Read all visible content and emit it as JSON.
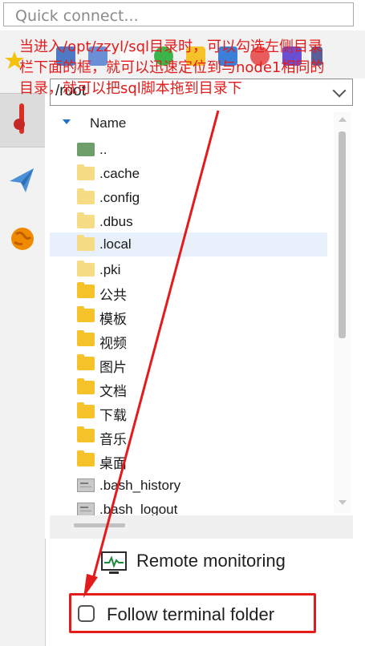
{
  "quick_connect": {
    "placeholder": "Quick connect..."
  },
  "path": {
    "value": "/root"
  },
  "file_list": {
    "header": "Name",
    "items": [
      {
        "name": "..",
        "type": "up"
      },
      {
        "name": ".cache",
        "type": "folder-light"
      },
      {
        "name": ".config",
        "type": "folder-light"
      },
      {
        "name": ".dbus",
        "type": "folder-light"
      },
      {
        "name": ".local",
        "type": "folder-light",
        "selected": true
      },
      {
        "name": ".pki",
        "type": "folder-light"
      },
      {
        "name": "公共",
        "type": "folder"
      },
      {
        "name": "模板",
        "type": "folder"
      },
      {
        "name": "视频",
        "type": "folder"
      },
      {
        "name": "图片",
        "type": "folder"
      },
      {
        "name": "文档",
        "type": "folder"
      },
      {
        "name": "下载",
        "type": "folder"
      },
      {
        "name": "音乐",
        "type": "folder"
      },
      {
        "name": "桌面",
        "type": "folder"
      },
      {
        "name": ".bash_history",
        "type": "file"
      },
      {
        "name": ".bash_logout",
        "type": "file"
      }
    ]
  },
  "remote_monitoring": {
    "label": "Remote monitoring"
  },
  "follow_terminal": {
    "label": "Follow terminal folder",
    "checked": false
  },
  "annotation": {
    "lines": [
      "当进入/opt/zzyl/sql目录时，可以勾选左侧目录",
      "栏下面的框，就可以迅速定位到与node1相同的",
      "目录，就可以把sql脚本拖到目录下"
    ]
  },
  "colors": {
    "annotation_red": "#e41b1b",
    "selected_row": "#e8f1fb",
    "folder_yellow": "#f6c22a",
    "folder_light": "#f7dc86"
  },
  "icons": {
    "left_tools": [
      "star-icon",
      "wrench-icon",
      "send-icon",
      "globe-icon"
    ],
    "toolbar": [
      "upload-icon",
      "download-icon",
      "refresh-icon",
      "new-folder-icon",
      "new-file-icon",
      "delete-icon",
      "rename-icon",
      "settings-icon"
    ]
  }
}
